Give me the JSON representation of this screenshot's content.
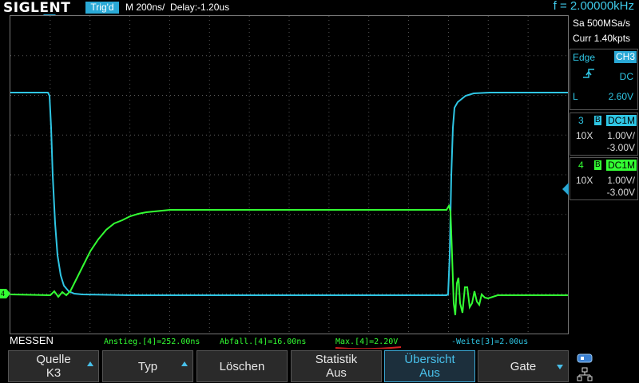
{
  "header": {
    "logo": "SIGLENT",
    "trigger_state": "Trig'd",
    "timebase": "M 200ns/",
    "delay": "Delay:-1.20us",
    "frequency": "f = 2.00000kHz"
  },
  "acquisition": {
    "sample_rate": "Sa 500MSa/s",
    "memory": "Curr 1.40kpts"
  },
  "trigger": {
    "type": "Edge",
    "source": "CH3",
    "coupling": "DC",
    "mode": "L",
    "level": "2.60V"
  },
  "channels": [
    {
      "number": "3",
      "bw": "B",
      "coupling": "DC1M",
      "probe": "10X",
      "scale": "1.00V/",
      "offset": "-3.00V",
      "color": "#2fc6e4"
    },
    {
      "number": "4",
      "bw": "B",
      "coupling": "DC1M",
      "probe": "10X",
      "scale": "1.00V/",
      "offset": "-3.00V",
      "color": "#33ff33"
    }
  ],
  "measurements": {
    "label": "MESSEN",
    "items": [
      {
        "text": "Anstieg.[4]=252.00ns",
        "color": "#33ff33"
      },
      {
        "text": "Abfall.[4]=16.00ns",
        "color": "#33ff33"
      },
      {
        "text": "Max.[4]=2.20V",
        "color": "#33ff33"
      },
      {
        "text": "-Weite[3]=2.00us",
        "color": "#2fc6e4"
      }
    ]
  },
  "softkeys": [
    {
      "line1": "Quelle",
      "line2": "K3"
    },
    {
      "line1": "Typ",
      "line2": ""
    },
    {
      "line1": "Löschen",
      "line2": ""
    },
    {
      "line1": "Statistik",
      "line2": "Aus"
    },
    {
      "line1": "Übersicht",
      "line2": "Aus"
    },
    {
      "line1": "Gate",
      "line2": ""
    }
  ],
  "ground_marker": "4",
  "colors": {
    "ch3": "#2fc6e4",
    "ch4": "#33ff33",
    "grid": "#555555",
    "highlight": "#d82020"
  }
}
